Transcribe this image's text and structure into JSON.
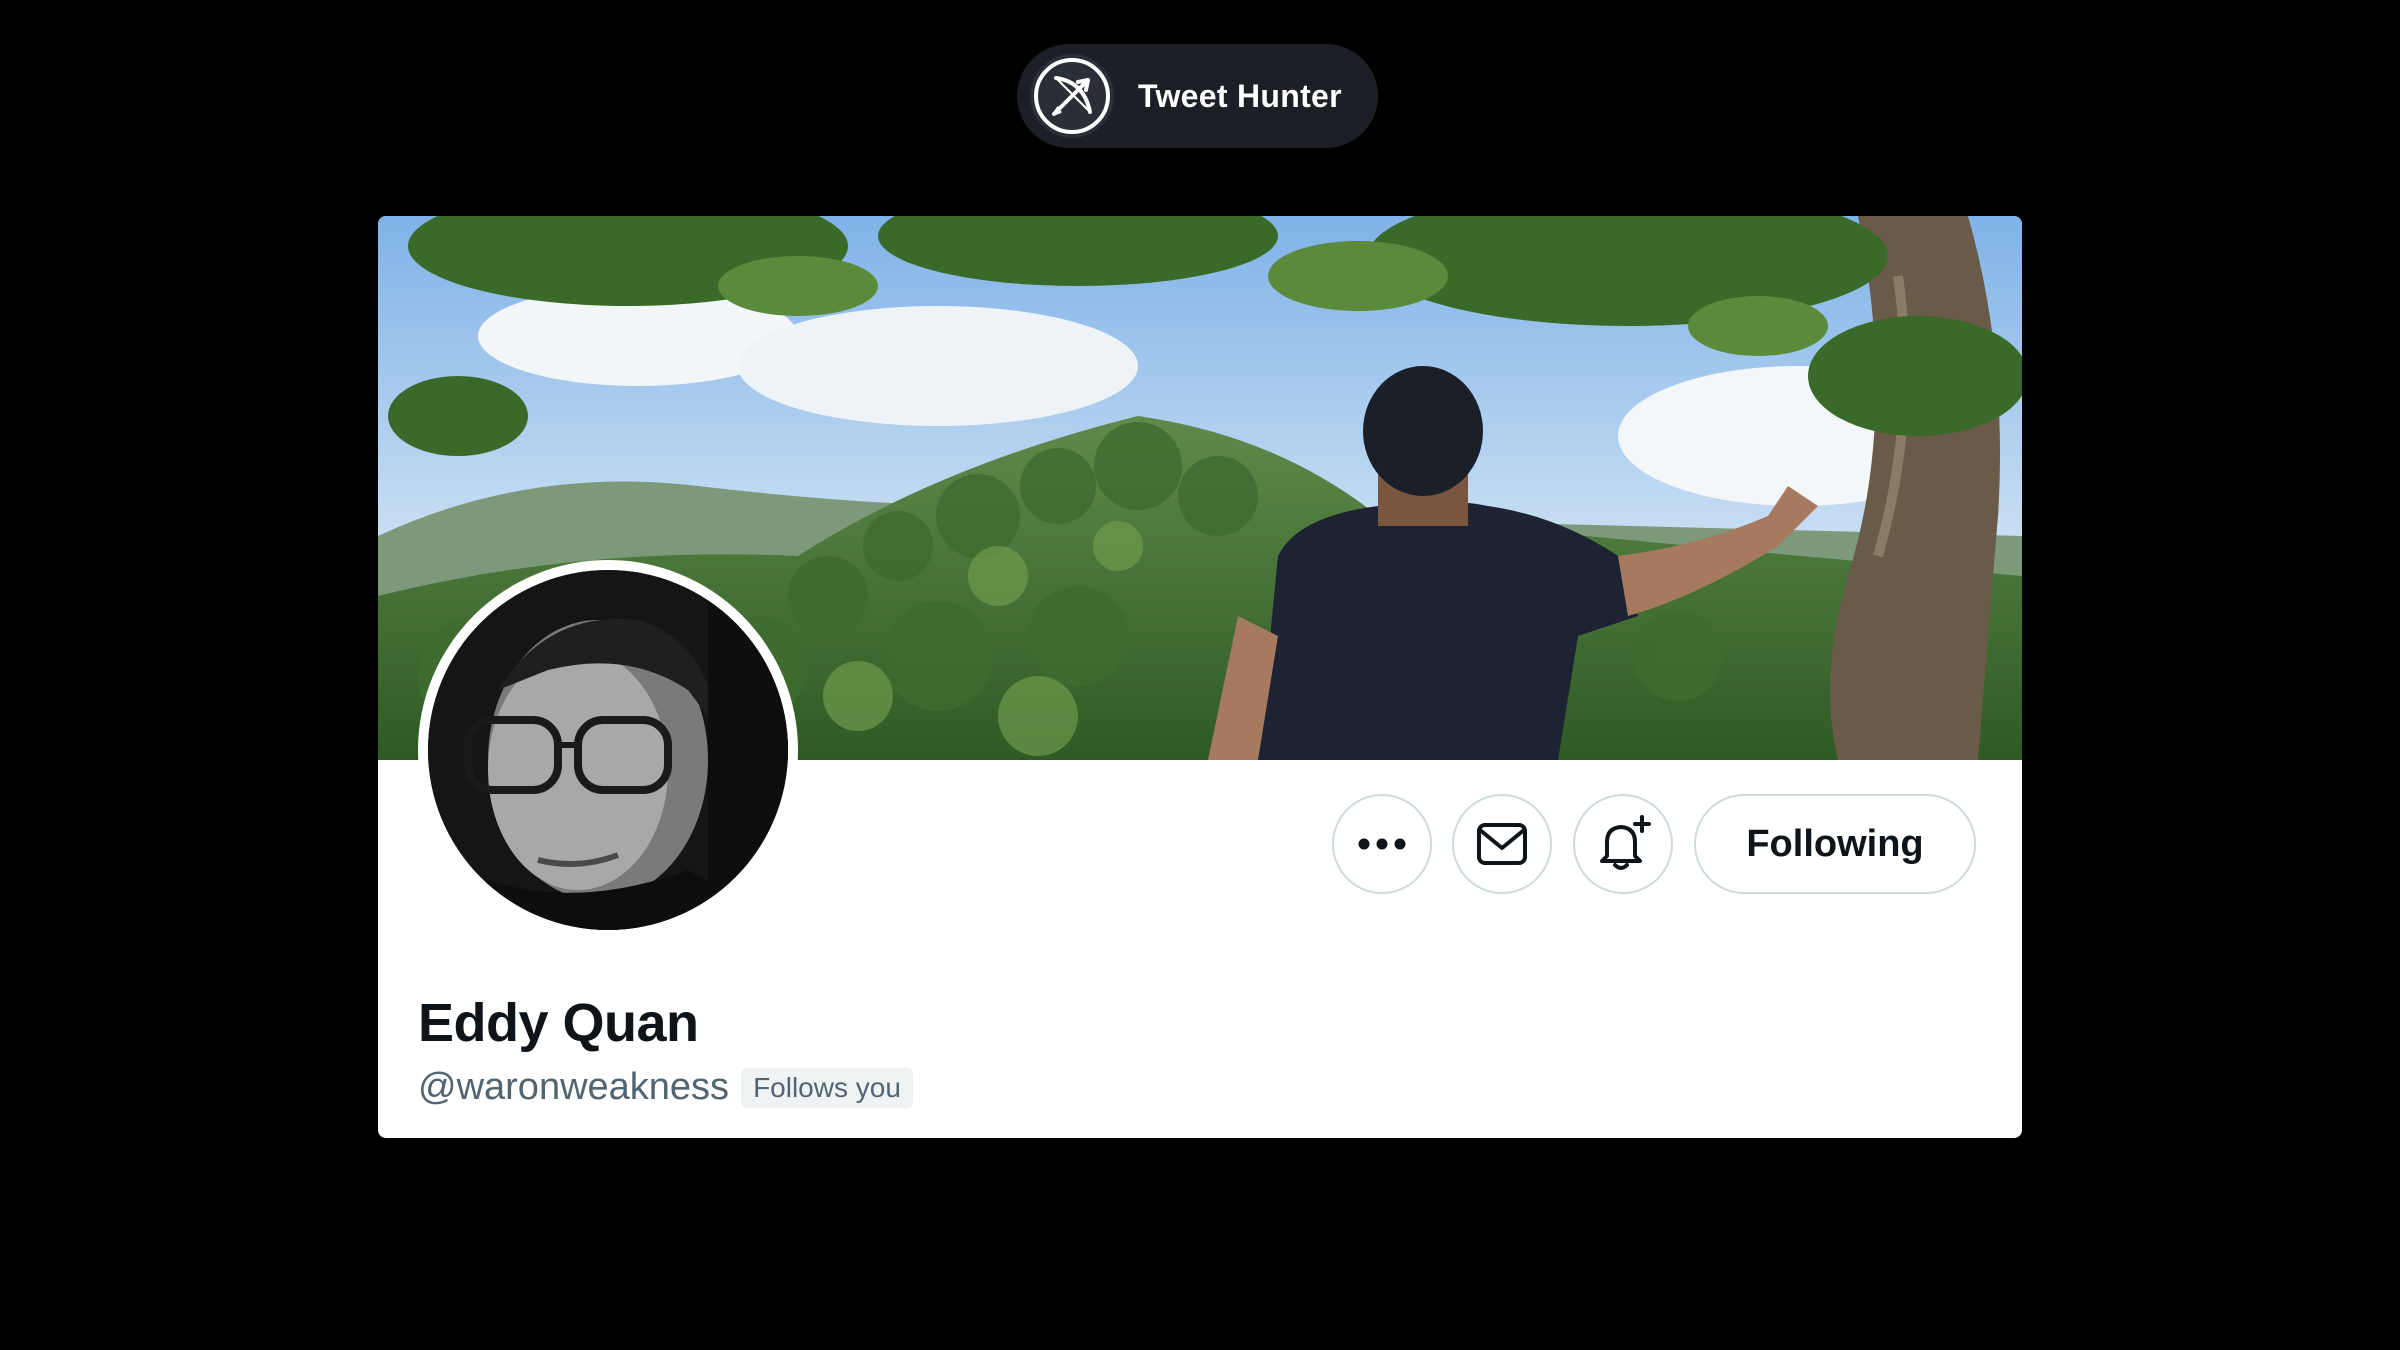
{
  "brand": {
    "name": "Tweet Hunter",
    "logo_icon": "bow-and-arrow-icon"
  },
  "profile": {
    "display_name": "Eddy Quan",
    "handle": "@waronweakness",
    "follows_you_label": "Follows you",
    "banner_image": "photo of man standing by tree overlooking forested mountains",
    "avatar_image": "black and white portrait of man with glasses"
  },
  "actions": {
    "more_icon": "more-horizontal-icon",
    "message_icon": "mail-icon",
    "notify_icon": "bell-plus-icon",
    "following_label": "Following"
  },
  "colors": {
    "background": "#000000",
    "card": "#ffffff",
    "primary_text": "#0f1419",
    "secondary_text": "#536471",
    "border": "#cfd9de",
    "pill": "#1c1f26"
  }
}
